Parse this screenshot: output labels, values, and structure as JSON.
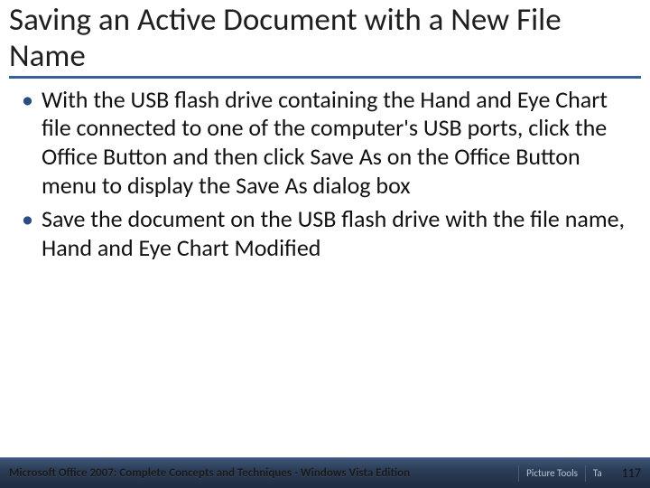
{
  "title": "Saving an Active Document with a New File Name",
  "bullets": [
    "With the USB flash drive containing the Hand and Eye Chart file connected to one of the computer's USB ports, click the Office Button and then click Save As on the Office Button menu to display the Save As dialog box",
    "Save the document on the USB flash drive with the file name, Hand and Eye Chart Modified"
  ],
  "footer": {
    "text": "Microsoft Office 2007: Complete Concepts and Techniques - Windows Vista Edition",
    "segment1": "Picture Tools",
    "segment2": "Ta",
    "page": "117"
  },
  "colors": {
    "accent": "#3a5e9a",
    "footer_bg": "#2b3d57"
  }
}
